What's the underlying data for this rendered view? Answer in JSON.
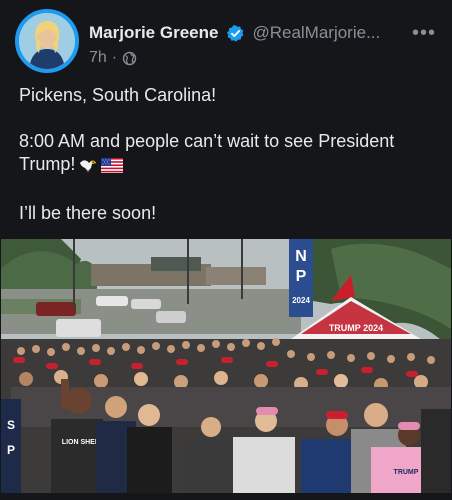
{
  "post": {
    "author_name": "Marjorie Greene",
    "handle": "@RealMarjorie...",
    "time": "7h",
    "separator": "·",
    "more_label": "•••",
    "text_line1": "Pickens, South Carolina!",
    "text_line2": "8:00 AM and people can’t wait to see President Trump!",
    "text_line3": "I’ll be there soon!",
    "emojis": [
      "eagle-icon",
      "us-flag-icon"
    ]
  },
  "photo": {
    "description_icon": "rally-crowd-photo",
    "sign_letters": [
      "N",
      "P"
    ],
    "sign_year": "2024",
    "tent_text": "TRUMP 2024",
    "shirt_text": "LION SHEEP",
    "pink_shirt_text": "TRUMP"
  },
  "colors": {
    "background": "#15161a",
    "text": "#e7e9ea",
    "secondary": "#8b8f95",
    "verified": "#1d9bf0"
  }
}
